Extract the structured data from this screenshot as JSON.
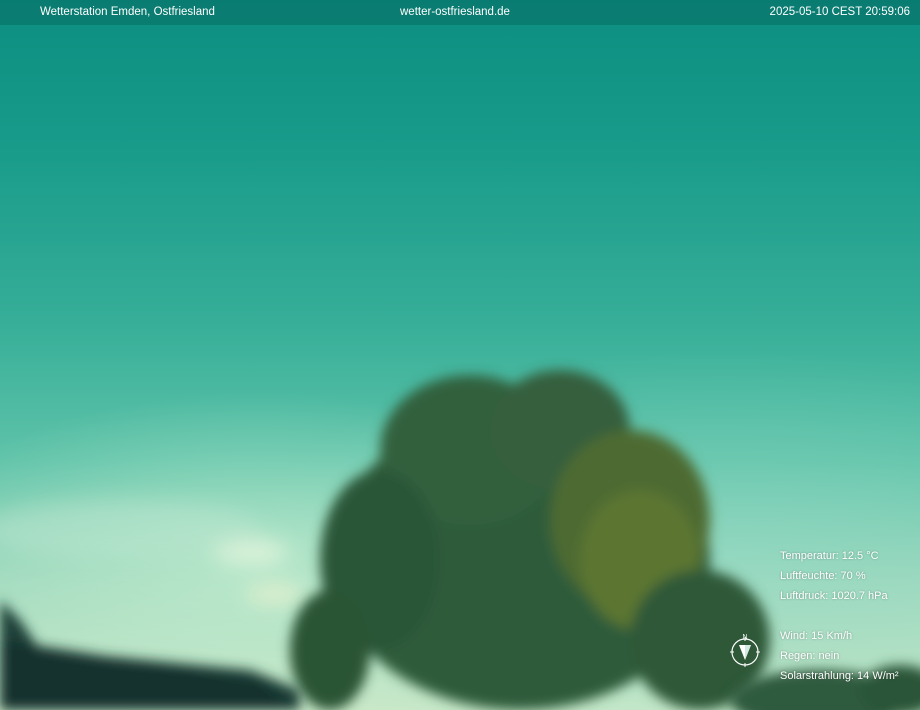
{
  "banner": {
    "station": "Wetterstation Emden, Ostfriesland",
    "website": "wetter-ostfriesland.de",
    "timestamp": "2025-05-10 CEST 20:59:06"
  },
  "readings": {
    "temperature": "Temperatur: 12.5 °C",
    "humidity": "Luftfeuchte: 70 %",
    "pressure": "Luftdruck: 1020.7 hPa",
    "wind": "Wind: 15 Km/h",
    "rain": "Regen: nein",
    "solar": "Solarstrahlung: 14 W/m²"
  },
  "compass": {
    "north_label": "N"
  },
  "colors": {
    "sky_top": "#0b8e80",
    "sky_horizon": "#c9e8c8",
    "tree": "#2f5b3a"
  }
}
